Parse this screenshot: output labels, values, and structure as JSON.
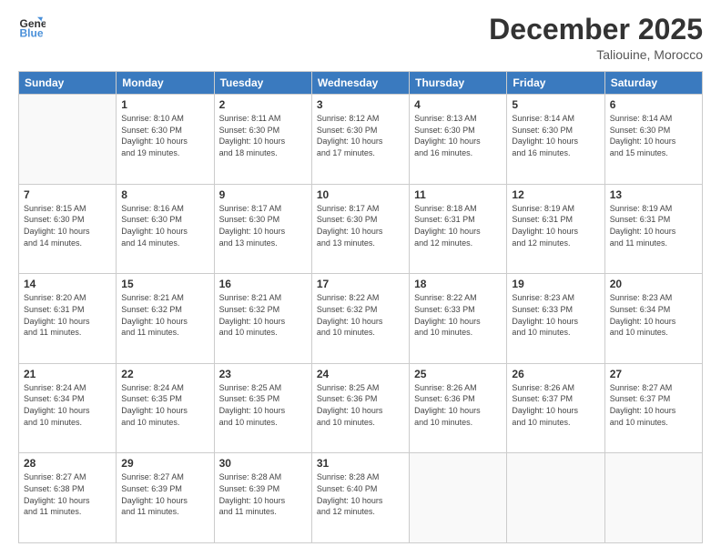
{
  "header": {
    "logo_line1": "General",
    "logo_line2": "Blue",
    "month_title": "December 2025",
    "location": "Taliouine, Morocco"
  },
  "days_of_week": [
    "Sunday",
    "Monday",
    "Tuesday",
    "Wednesday",
    "Thursday",
    "Friday",
    "Saturday"
  ],
  "weeks": [
    [
      {
        "day": "",
        "info": ""
      },
      {
        "day": "1",
        "info": "Sunrise: 8:10 AM\nSunset: 6:30 PM\nDaylight: 10 hours\nand 19 minutes."
      },
      {
        "day": "2",
        "info": "Sunrise: 8:11 AM\nSunset: 6:30 PM\nDaylight: 10 hours\nand 18 minutes."
      },
      {
        "day": "3",
        "info": "Sunrise: 8:12 AM\nSunset: 6:30 PM\nDaylight: 10 hours\nand 17 minutes."
      },
      {
        "day": "4",
        "info": "Sunrise: 8:13 AM\nSunset: 6:30 PM\nDaylight: 10 hours\nand 16 minutes."
      },
      {
        "day": "5",
        "info": "Sunrise: 8:14 AM\nSunset: 6:30 PM\nDaylight: 10 hours\nand 16 minutes."
      },
      {
        "day": "6",
        "info": "Sunrise: 8:14 AM\nSunset: 6:30 PM\nDaylight: 10 hours\nand 15 minutes."
      }
    ],
    [
      {
        "day": "7",
        "info": "Sunrise: 8:15 AM\nSunset: 6:30 PM\nDaylight: 10 hours\nand 14 minutes."
      },
      {
        "day": "8",
        "info": "Sunrise: 8:16 AM\nSunset: 6:30 PM\nDaylight: 10 hours\nand 14 minutes."
      },
      {
        "day": "9",
        "info": "Sunrise: 8:17 AM\nSunset: 6:30 PM\nDaylight: 10 hours\nand 13 minutes."
      },
      {
        "day": "10",
        "info": "Sunrise: 8:17 AM\nSunset: 6:30 PM\nDaylight: 10 hours\nand 13 minutes."
      },
      {
        "day": "11",
        "info": "Sunrise: 8:18 AM\nSunset: 6:31 PM\nDaylight: 10 hours\nand 12 minutes."
      },
      {
        "day": "12",
        "info": "Sunrise: 8:19 AM\nSunset: 6:31 PM\nDaylight: 10 hours\nand 12 minutes."
      },
      {
        "day": "13",
        "info": "Sunrise: 8:19 AM\nSunset: 6:31 PM\nDaylight: 10 hours\nand 11 minutes."
      }
    ],
    [
      {
        "day": "14",
        "info": "Sunrise: 8:20 AM\nSunset: 6:31 PM\nDaylight: 10 hours\nand 11 minutes."
      },
      {
        "day": "15",
        "info": "Sunrise: 8:21 AM\nSunset: 6:32 PM\nDaylight: 10 hours\nand 11 minutes."
      },
      {
        "day": "16",
        "info": "Sunrise: 8:21 AM\nSunset: 6:32 PM\nDaylight: 10 hours\nand 10 minutes."
      },
      {
        "day": "17",
        "info": "Sunrise: 8:22 AM\nSunset: 6:32 PM\nDaylight: 10 hours\nand 10 minutes."
      },
      {
        "day": "18",
        "info": "Sunrise: 8:22 AM\nSunset: 6:33 PM\nDaylight: 10 hours\nand 10 minutes."
      },
      {
        "day": "19",
        "info": "Sunrise: 8:23 AM\nSunset: 6:33 PM\nDaylight: 10 hours\nand 10 minutes."
      },
      {
        "day": "20",
        "info": "Sunrise: 8:23 AM\nSunset: 6:34 PM\nDaylight: 10 hours\nand 10 minutes."
      }
    ],
    [
      {
        "day": "21",
        "info": "Sunrise: 8:24 AM\nSunset: 6:34 PM\nDaylight: 10 hours\nand 10 minutes."
      },
      {
        "day": "22",
        "info": "Sunrise: 8:24 AM\nSunset: 6:35 PM\nDaylight: 10 hours\nand 10 minutes."
      },
      {
        "day": "23",
        "info": "Sunrise: 8:25 AM\nSunset: 6:35 PM\nDaylight: 10 hours\nand 10 minutes."
      },
      {
        "day": "24",
        "info": "Sunrise: 8:25 AM\nSunset: 6:36 PM\nDaylight: 10 hours\nand 10 minutes."
      },
      {
        "day": "25",
        "info": "Sunrise: 8:26 AM\nSunset: 6:36 PM\nDaylight: 10 hours\nand 10 minutes."
      },
      {
        "day": "26",
        "info": "Sunrise: 8:26 AM\nSunset: 6:37 PM\nDaylight: 10 hours\nand 10 minutes."
      },
      {
        "day": "27",
        "info": "Sunrise: 8:27 AM\nSunset: 6:37 PM\nDaylight: 10 hours\nand 10 minutes."
      }
    ],
    [
      {
        "day": "28",
        "info": "Sunrise: 8:27 AM\nSunset: 6:38 PM\nDaylight: 10 hours\nand 11 minutes."
      },
      {
        "day": "29",
        "info": "Sunrise: 8:27 AM\nSunset: 6:39 PM\nDaylight: 10 hours\nand 11 minutes."
      },
      {
        "day": "30",
        "info": "Sunrise: 8:28 AM\nSunset: 6:39 PM\nDaylight: 10 hours\nand 11 minutes."
      },
      {
        "day": "31",
        "info": "Sunrise: 8:28 AM\nSunset: 6:40 PM\nDaylight: 10 hours\nand 12 minutes."
      },
      {
        "day": "",
        "info": ""
      },
      {
        "day": "",
        "info": ""
      },
      {
        "day": "",
        "info": ""
      }
    ]
  ]
}
